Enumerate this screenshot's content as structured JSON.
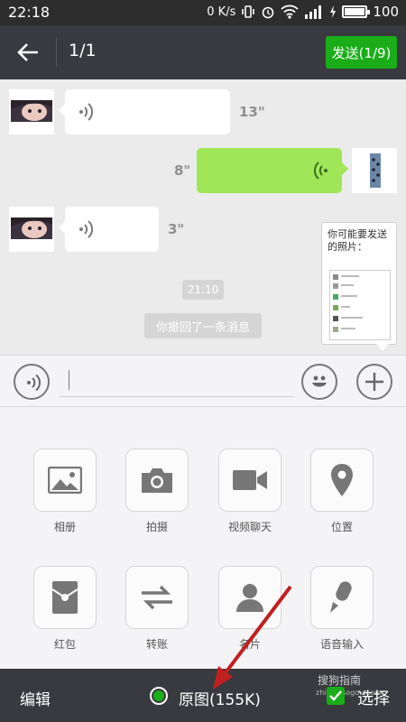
{
  "status_bar": {
    "time": "22:18",
    "net_speed": "0 K/s",
    "battery": "100",
    "battery_level": 1.0
  },
  "header": {
    "back_icon": "arrow-left-icon",
    "title": "1/1",
    "send_label": "发送(1/9)",
    "send_color": "#1aad19"
  },
  "chat": {
    "messages": [
      {
        "side": "left",
        "type": "voice",
        "duration": "13\""
      },
      {
        "side": "right",
        "type": "voice",
        "duration": "8\""
      },
      {
        "side": "left",
        "type": "voice",
        "duration": "3\""
      }
    ],
    "timestamp": "21:10",
    "system_message": "你撤回了一条消息"
  },
  "photo_popup": {
    "text": "你可能要发送的照片："
  },
  "input_bar": {
    "voice_icon": "voice-icon",
    "emoji_icon": "smiley-icon",
    "plus_icon": "plus-icon"
  },
  "features": [
    {
      "label": "相册",
      "icon": "image-icon"
    },
    {
      "label": "拍摄",
      "icon": "camera-icon"
    },
    {
      "label": "视频聊天",
      "icon": "video-icon"
    },
    {
      "label": "位置",
      "icon": "location-pin-icon"
    },
    {
      "label": "红包",
      "icon": "red-packet-icon"
    },
    {
      "label": "转账",
      "icon": "transfer-icon"
    },
    {
      "label": "名片",
      "icon": "contact-card-icon"
    },
    {
      "label": "语音输入",
      "icon": "microphone-icon"
    }
  ],
  "bottom_bar": {
    "edit_label": "编辑",
    "original_label": "原图(155K)",
    "select_label": "选择",
    "watermark": "搜狗指南",
    "watermark_sub": "zhinan.sogou.com"
  }
}
